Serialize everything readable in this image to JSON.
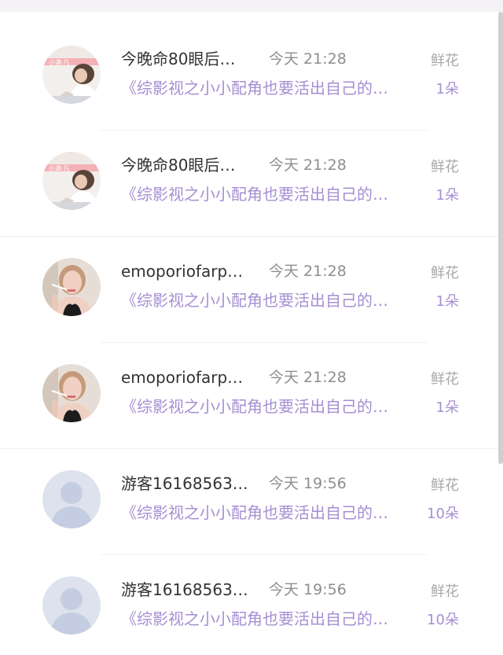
{
  "colors": {
    "accent_purple": "#a58fd3",
    "name_text": "#333333",
    "meta_text": "#8e8e8e",
    "gift_label": "#a8a8a8"
  },
  "records": [
    {
      "avatar": "photo-woman-banner",
      "avatar_banner": "小满·凡",
      "name": "今晚命80眼后…",
      "time": "今天 21:28",
      "gift_type": "鲜花",
      "book": "《综影视之小小配角也要活出自己的…",
      "count": "1朵"
    },
    {
      "avatar": "photo-woman-banner",
      "avatar_banner": "小满·凡",
      "name": "今晚命80眼后…",
      "time": "今天 21:28",
      "gift_type": "鲜花",
      "book": "《综影视之小小配角也要活出自己的…",
      "count": "1朵"
    },
    {
      "avatar": "photo-woman-smoking",
      "name": "emoporiofarp…",
      "time": "今天 21:28",
      "gift_type": "鲜花",
      "book": "《综影视之小小配角也要活出自己的…",
      "count": "1朵"
    },
    {
      "avatar": "photo-woman-smoking",
      "name": "emoporiofarp…",
      "time": "今天 21:28",
      "gift_type": "鲜花",
      "book": "《综影视之小小配角也要活出自己的…",
      "count": "1朵"
    },
    {
      "avatar": "default-user-icon",
      "name": "游客16168563…",
      "time": "今天 19:56",
      "gift_type": "鲜花",
      "book": "《综影视之小小配角也要活出自己的…",
      "count": "10朵"
    },
    {
      "avatar": "default-user-icon",
      "name": "游客16168563…",
      "time": "今天 19:56",
      "gift_type": "鲜花",
      "book": "《综影视之小小配角也要活出自己的…",
      "count": "10朵"
    }
  ]
}
